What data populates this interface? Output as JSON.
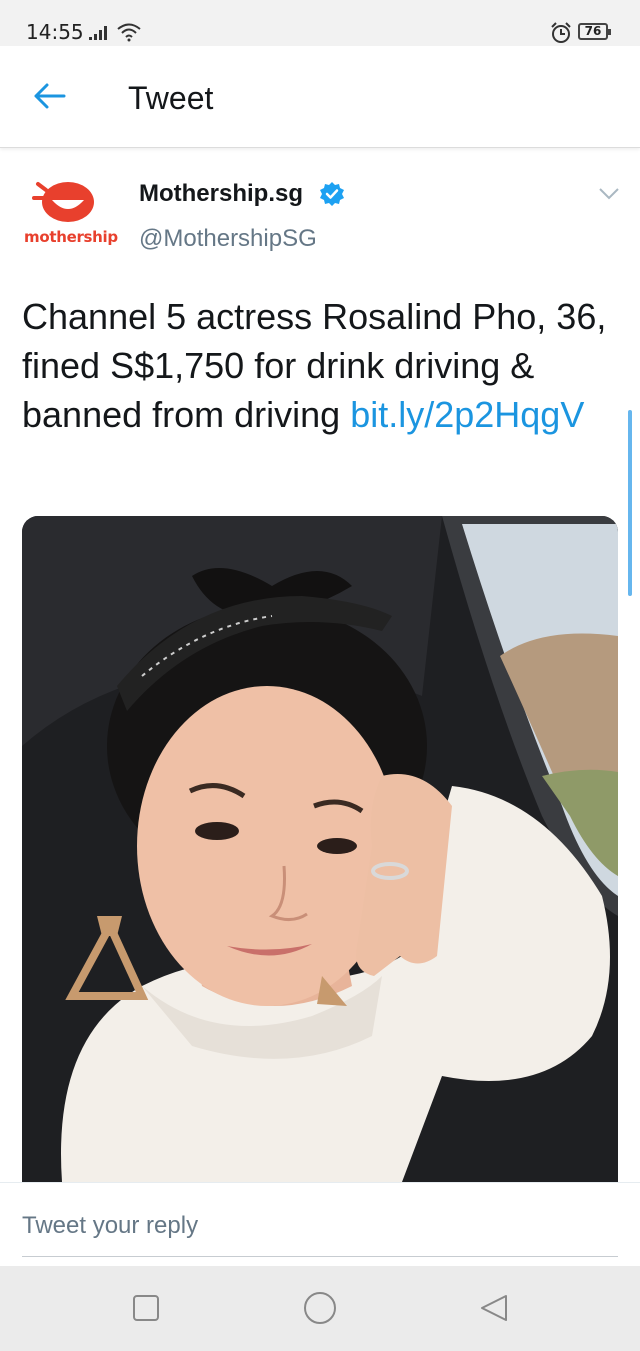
{
  "status_bar": {
    "time": "14:55",
    "battery": "76",
    "icons": [
      "signal-icon",
      "wifi-icon",
      "alarm-icon",
      "battery-icon"
    ]
  },
  "header": {
    "title": "Tweet",
    "back_icon": "arrow-left-icon"
  },
  "tweet": {
    "author_name": "Mothership.sg",
    "author_handle": "@MothershipSG",
    "avatar_text": "mothership",
    "verified": true,
    "text_plain": "Channel 5 actress Rosalind Pho, 36, fined S$1,750 for drink driving & banned from driving ",
    "link_text": "bit.ly/​2p2HqgV",
    "media_subject": "photo"
  },
  "reply": {
    "placeholder": "Tweet your reply"
  },
  "nav": {
    "items": [
      "square-icon",
      "circle-icon",
      "triangle-back-icon"
    ]
  },
  "colors": {
    "accent": "#1b95e0",
    "verified": "#1da1f2",
    "brand": "#e8402d",
    "secondary_text": "#657786"
  }
}
